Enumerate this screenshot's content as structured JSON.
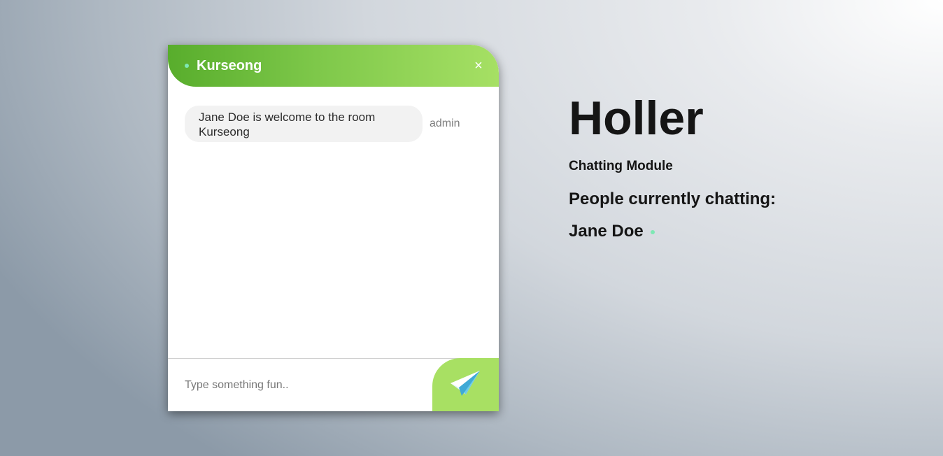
{
  "chat": {
    "room_name": "Kurseong",
    "close_label": "×",
    "messages": [
      {
        "text": "Jane Doe is welcome to the room Kurseong",
        "sender": "admin"
      }
    ],
    "input": {
      "placeholder": "Type something fun..",
      "value": ""
    },
    "send_icon": "paper-plane-icon"
  },
  "info": {
    "title": "Holler",
    "subtitle": "Chatting Module",
    "people_heading": "People currently chatting:",
    "people": [
      {
        "name": "Jane Doe",
        "status": "online"
      }
    ]
  },
  "colors": {
    "header_gradient_start": "#58ad2c",
    "header_gradient_end": "#a6e064",
    "send_button": "#a8e063",
    "online_indicator": "#7ee8b4",
    "bubble_background": "#f2f2f2"
  }
}
